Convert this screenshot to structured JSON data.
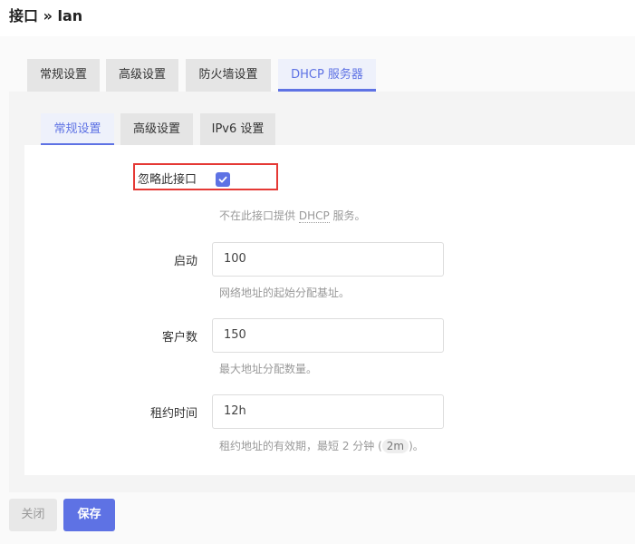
{
  "header": {
    "title": "接口 » lan"
  },
  "outer_tabs": [
    {
      "label": "常规设置"
    },
    {
      "label": "高级设置"
    },
    {
      "label": "防火墙设置"
    },
    {
      "label": "DHCP 服务器",
      "active": true
    }
  ],
  "inner_tabs": [
    {
      "label": "常规设置",
      "active": true
    },
    {
      "label": "高级设置"
    },
    {
      "label": "IPv6 设置"
    }
  ],
  "form": {
    "ignore_interface": {
      "label": "忽略此接口",
      "checked": true,
      "hint_prefix": "不在此接口提供 ",
      "hint_abbr": "DHCP",
      "hint_suffix": " 服务。"
    },
    "start": {
      "label": "启动",
      "value": "100",
      "hint": "网络地址的起始分配基址。"
    },
    "limit": {
      "label": "客户数",
      "value": "150",
      "hint": "最大地址分配数量。"
    },
    "lease_time": {
      "label": "租约时间",
      "value": "12h",
      "hint_prefix": "租约地址的有效期，最短 2 分钟 (",
      "hint_code": "2m",
      "hint_suffix": ")。"
    }
  },
  "buttons": {
    "close": "关闭",
    "save": "保存"
  },
  "colors": {
    "accent": "#5e72e4",
    "highlight": "#e53935"
  }
}
